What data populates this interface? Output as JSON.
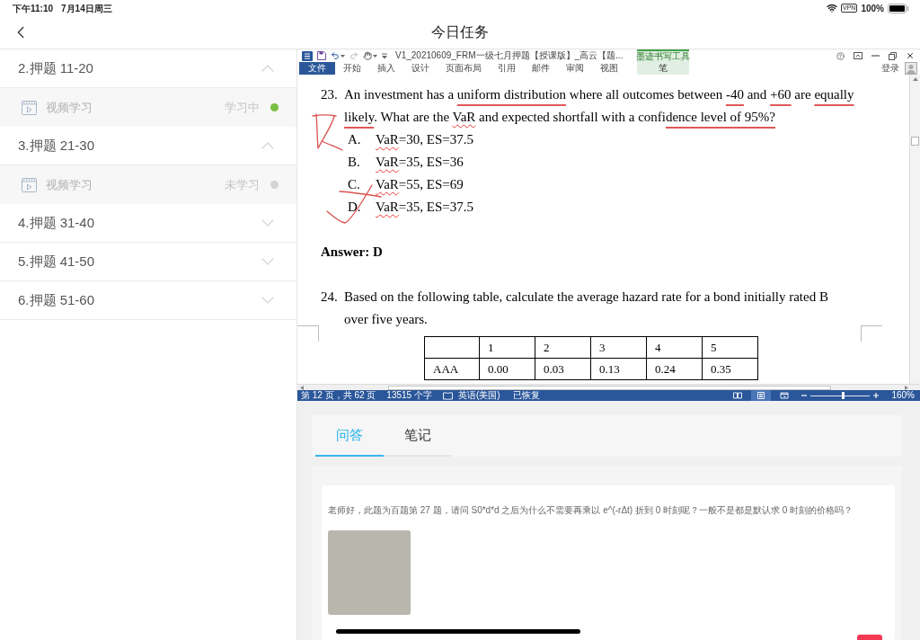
{
  "status_bar": {
    "time": "下午11:10",
    "date": "7月14日周三",
    "vpn": "VPN",
    "battery": "100%"
  },
  "nav_bar": {
    "title": "今日任务"
  },
  "sidebar": {
    "sections": [
      {
        "title": "2.押题 11-20",
        "expanded": true,
        "lessons": [
          {
            "type": "视频学习",
            "status": "学习中",
            "color": "#7ac143"
          }
        ]
      },
      {
        "title": "3.押题 21-30",
        "expanded": true,
        "lessons": [
          {
            "type": "视频学习",
            "status": "未学习",
            "color": "#d3d3d3"
          }
        ]
      },
      {
        "title": "4.押题 31-40",
        "expanded": false
      },
      {
        "title": "5.押题 41-50",
        "expanded": false
      },
      {
        "title": "6.押题 51-60",
        "expanded": false
      }
    ]
  },
  "word_window": {
    "title": "V1_20210609_FRM一级七月押题【授课版】_高云【题...",
    "context_group": "墨迹书写工具",
    "account": "登录",
    "tabs": [
      {
        "label": "文件",
        "kind": "file"
      },
      {
        "label": "开始",
        "kind": "normal"
      },
      {
        "label": "插入",
        "kind": "normal"
      },
      {
        "label": "设计",
        "kind": "normal"
      },
      {
        "label": "页面布局",
        "kind": "normal"
      },
      {
        "label": "引用",
        "kind": "normal"
      },
      {
        "label": "邮件",
        "kind": "normal"
      },
      {
        "label": "审阅",
        "kind": "normal"
      },
      {
        "label": "视图",
        "kind": "normal"
      },
      {
        "label": "笔",
        "kind": "context"
      }
    ],
    "document": {
      "questions": [
        {
          "number": "23.",
          "lines": [
            [
              {
                "text": "An investment has a ",
                "kind": "plain"
              },
              {
                "text": "uniform distribution",
                "kind": "ink"
              },
              {
                "text": " where all outcomes between ",
                "kind": "plain"
              },
              {
                "text": "-40",
                "kind": "ink"
              },
              {
                "text": " and ",
                "kind": "plain"
              },
              {
                "text": "+60",
                "kind": "ink"
              },
              {
                "text": " are ",
                "kind": "plain"
              },
              {
                "text": "equally",
                "kind": "ink"
              }
            ],
            [
              {
                "text": "likely",
                "kind": "ink"
              },
              {
                "text": ". What are the ",
                "kind": "plain"
              },
              {
                "text": "VaR",
                "kind": "spell"
              },
              {
                "text": " and expected shortfall with a confi",
                "kind": "plain"
              },
              {
                "text": "dence level of 95%?",
                "kind": "ink"
              }
            ]
          ],
          "options": [
            {
              "letter": "A.",
              "segments": [
                {
                  "text": "VaR",
                  "kind": "spell"
                },
                {
                  "text": "=30, ES=37.5",
                  "kind": "plain"
                }
              ]
            },
            {
              "letter": "B.",
              "segments": [
                {
                  "text": "VaR",
                  "kind": "spell"
                },
                {
                  "text": "=35, ES=36",
                  "kind": "plain"
                }
              ]
            },
            {
              "letter": "C.",
              "segments": [
                {
                  "text": "VaR",
                  "kind": "spell"
                },
                {
                  "text": "=55, ES=69",
                  "kind": "plain"
                }
              ]
            },
            {
              "letter": "D.",
              "segments": [
                {
                  "text": "VaR",
                  "kind": "spell"
                },
                {
                  "text": "=35, ES=37.5",
                  "kind": "plain"
                }
              ]
            }
          ],
          "answer": "Answer: D"
        },
        {
          "number": "24.",
          "lines": [
            [
              {
                "text": "Based on the following table, calculate the average hazard rate for a bond initially rated B",
                "kind": "plain"
              }
            ],
            [
              {
                "text": "over five years.",
                "kind": "plain"
              }
            ]
          ],
          "table": {
            "columns": [
              "1",
              "2",
              "3",
              "4",
              "5"
            ],
            "rows": [
              {
                "label": "AAA",
                "values": [
                  "0.00",
                  "0.03",
                  "0.13",
                  "0.24",
                  "0.35"
                ]
              }
            ]
          }
        }
      ]
    },
    "status": {
      "page": "第 12 页，共 62 页",
      "words": "13515 个字",
      "language": "英语(美国)",
      "recovery": "已恢复",
      "views": [
        {
          "kind": "read",
          "selected": false
        },
        {
          "kind": "print",
          "selected": true
        },
        {
          "kind": "web",
          "selected": false
        }
      ],
      "zoom": {
        "level": 0.55,
        "reading": "160%"
      }
    }
  },
  "qa_panel": {
    "tabs": [
      {
        "label": "问答",
        "selected": true
      },
      {
        "label": "笔记",
        "selected": false
      }
    ],
    "question": "老师好，此题为百题第 27 题，请问 S0*d*d 之后为什么不需要再乘以 e^(-rΔt) 折到 0 时刻呢？一般不是都是默认求 0 时刻的价格吗？"
  }
}
